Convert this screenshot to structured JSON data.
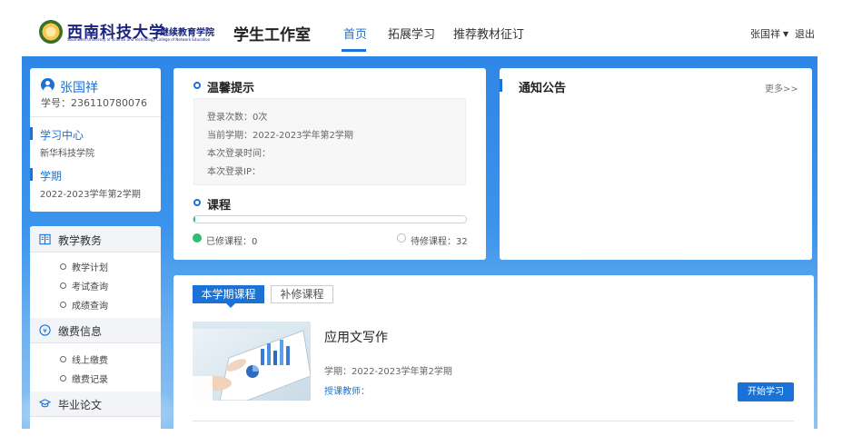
{
  "header": {
    "logo_cn": "西南科技大学",
    "logo_sub": "继续教育学院",
    "logo_en": "Southwest University of Science and Technology College of Network Education",
    "site_title": "学生工作室",
    "nav": [
      "首页",
      "拓展学习",
      "推荐教材征订"
    ],
    "active_nav": "首页",
    "user": "张国祥",
    "logout": "退出"
  },
  "profile": {
    "name": "张国祥",
    "student_id": "学号：236110780076",
    "study_center_title": "学习中心",
    "study_center_value": "新华科技学院",
    "term_title": "学期",
    "term_value": "2022-2023学年第2学期"
  },
  "menu": {
    "groups": [
      {
        "label": "教学教务",
        "icon": "book-icon",
        "items": [
          "教学计划",
          "考试查询",
          "成绩查询"
        ]
      },
      {
        "label": "缴费信息",
        "icon": "yen-icon",
        "items": [
          "线上缴费",
          "缴费记录"
        ]
      },
      {
        "label": "毕业论文",
        "icon": "graduation-cap-icon",
        "items": []
      }
    ]
  },
  "tips": {
    "title": "温馨提示",
    "lines": [
      "登录次数：0次",
      "当前学期：2022-2023学年第2学期",
      "本次登录时间：",
      "本次登录IP："
    ]
  },
  "course_progress": {
    "title": "课程",
    "completed_label": "已修课程：0",
    "pending_label": "待修课程：32",
    "completed": 0,
    "pending": 32,
    "colors": {
      "completed": "#2bbf72",
      "pending": "#ffffff"
    }
  },
  "notice": {
    "title": "通知公告",
    "more": "更多>>"
  },
  "courses": {
    "tabs": [
      "本学期课程",
      "补修课程"
    ],
    "active_tab": "本学期课程",
    "items": [
      {
        "title": "应用文写作",
        "term": "学期：2022-2023学年第2学期",
        "teacher": "授课教师：",
        "button": "开始学习"
      }
    ]
  },
  "theme": {
    "accent": "#1a72d6",
    "band": "#2f86e6"
  }
}
